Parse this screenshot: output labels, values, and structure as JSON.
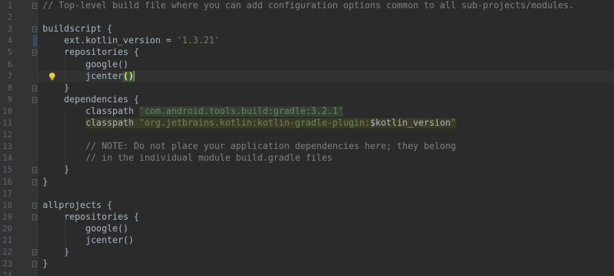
{
  "editor": {
    "lines": [
      {
        "num": "1",
        "tokens": [
          {
            "t": "// Top-level build file where you can add configuration options common to all sub-projects/modules.",
            "c": "comment"
          }
        ]
      },
      {
        "num": "2",
        "tokens": []
      },
      {
        "num": "3",
        "tokens": [
          {
            "t": "buildscript {",
            "c": ""
          }
        ]
      },
      {
        "num": "4",
        "tokens": [
          {
            "t": "    ext.kotlin_version = ",
            "c": ""
          },
          {
            "t": "'1.3.21'",
            "c": "str"
          }
        ]
      },
      {
        "num": "5",
        "tokens": [
          {
            "t": "    repositories {",
            "c": ""
          }
        ]
      },
      {
        "num": "6",
        "tokens": [
          {
            "t": "        google()",
            "c": ""
          }
        ]
      },
      {
        "num": "7",
        "tokens": [
          {
            "t": "        jcenter",
            "c": ""
          },
          {
            "t": "()",
            "c": "paren-match"
          }
        ]
      },
      {
        "num": "8",
        "tokens": [
          {
            "t": "    }",
            "c": ""
          }
        ]
      },
      {
        "num": "9",
        "tokens": [
          {
            "t": "    dependencies {",
            "c": ""
          }
        ]
      },
      {
        "num": "10",
        "tokens": [
          {
            "t": "        ",
            "c": ""
          },
          {
            "t": "classpath ",
            "c": ""
          },
          {
            "t": "'com.android.tools.build:gradle:3.2.1'",
            "c": "str hl-str"
          }
        ]
      },
      {
        "num": "11",
        "tokens": [
          {
            "t": "        ",
            "c": ""
          },
          {
            "t": "classpath ",
            "c": "hl-ref"
          },
          {
            "t": "\"org.jetbrains.kotlin:kotlin-gradle-plugin:",
            "c": "str hl-ref"
          },
          {
            "t": "$kotlin_version",
            "c": "hl-ref"
          },
          {
            "t": "\"",
            "c": "str hl-ref"
          }
        ]
      },
      {
        "num": "12",
        "tokens": []
      },
      {
        "num": "13",
        "tokens": [
          {
            "t": "        // NOTE: Do not place your application dependencies here; they belong",
            "c": "comment"
          }
        ]
      },
      {
        "num": "14",
        "tokens": [
          {
            "t": "        // in the individual module build.gradle files",
            "c": "comment"
          }
        ]
      },
      {
        "num": "15",
        "tokens": [
          {
            "t": "    }",
            "c": ""
          }
        ]
      },
      {
        "num": "16",
        "tokens": [
          {
            "t": "}",
            "c": ""
          }
        ]
      },
      {
        "num": "17",
        "tokens": []
      },
      {
        "num": "18",
        "tokens": [
          {
            "t": "allprojects {",
            "c": ""
          }
        ]
      },
      {
        "num": "19",
        "tokens": [
          {
            "t": "    repositories {",
            "c": ""
          }
        ]
      },
      {
        "num": "20",
        "tokens": [
          {
            "t": "        google()",
            "c": ""
          }
        ]
      },
      {
        "num": "21",
        "tokens": [
          {
            "t": "        jcenter()",
            "c": ""
          }
        ]
      },
      {
        "num": "22",
        "tokens": [
          {
            "t": "    }",
            "c": ""
          }
        ]
      },
      {
        "num": "23",
        "tokens": [
          {
            "t": "}",
            "c": ""
          }
        ]
      },
      {
        "num": "24",
        "tokens": []
      }
    ],
    "current_line": "7",
    "fold_lines": [
      "1",
      "3",
      "5",
      "8",
      "9",
      "15",
      "16",
      "18",
      "19",
      "22",
      "23"
    ],
    "colors": {
      "background": "#2b2b2b",
      "gutter": "#313335",
      "comment": "#808080",
      "string": "#6a8759",
      "text": "#a9b7c6",
      "bracket_match": "#ffef28"
    },
    "icons": [
      "lightbulb-icon",
      "fold-marker-icon"
    ]
  }
}
